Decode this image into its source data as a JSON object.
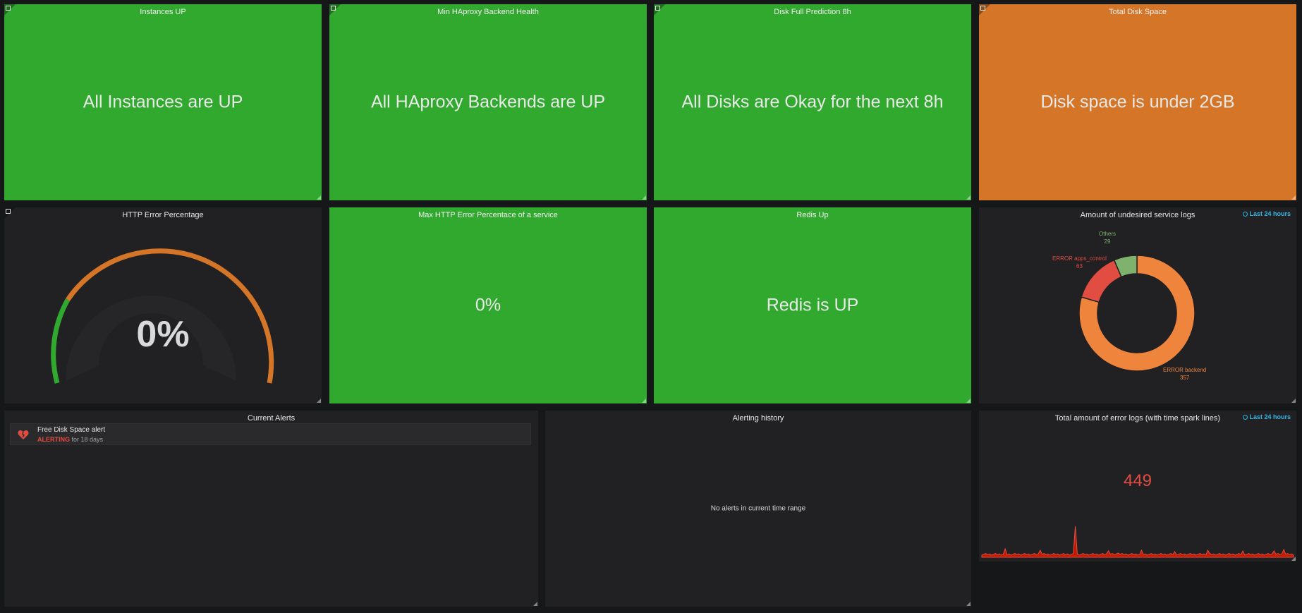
{
  "panels": {
    "instances_up": {
      "title": "Instances UP",
      "value": "All Instances are UP"
    },
    "haproxy": {
      "title": "Min HAproxy Backend Health",
      "value": "All HAproxy Backends are UP"
    },
    "disk_prediction": {
      "title": "Disk Full Prediction 8h",
      "value": "All Disks are Okay for the next 8h"
    },
    "total_disk": {
      "title": "Total Disk Space",
      "value": "Disk space is under 2GB"
    },
    "http_error": {
      "title": "HTTP Error Percentage",
      "value": "0%"
    },
    "max_http_error": {
      "title": "Max HTTP Error Percentace of a service",
      "value": "0%"
    },
    "redis": {
      "title": "Redis Up",
      "value": "Redis is UP"
    },
    "undesired_logs": {
      "title": "Amount of undesired service logs",
      "time_range": "Last 24 hours",
      "slices": [
        {
          "label": "ERROR backend",
          "value": "357",
          "color": "#ef843c"
        },
        {
          "label": "ERROR apps_control",
          "value": "63",
          "color": "#e24d42"
        },
        {
          "label": "Others",
          "value": "29",
          "color": "#7eb26d"
        }
      ]
    },
    "current_alerts": {
      "title": "Current Alerts",
      "alerts": [
        {
          "name": "Free Disk Space alert",
          "state": "ALERTING",
          "since": "for 18 days",
          "icon": "broken-heart-icon"
        }
      ]
    },
    "alerting_history": {
      "title": "Alerting history",
      "empty_message": "No alerts in current time range"
    },
    "total_error_logs": {
      "title": "Total amount of error logs (with time spark lines)",
      "time_range": "Last 24 hours",
      "value": "449"
    }
  },
  "colors": {
    "ok": "#31a82e",
    "warn": "#d57528",
    "alert": "#e24d42",
    "link": "#33b5e5",
    "panel_bg": "#212124"
  },
  "gauge": {
    "value_percent": 0,
    "thresholds": [
      "#31a82e",
      "#d57528"
    ]
  }
}
